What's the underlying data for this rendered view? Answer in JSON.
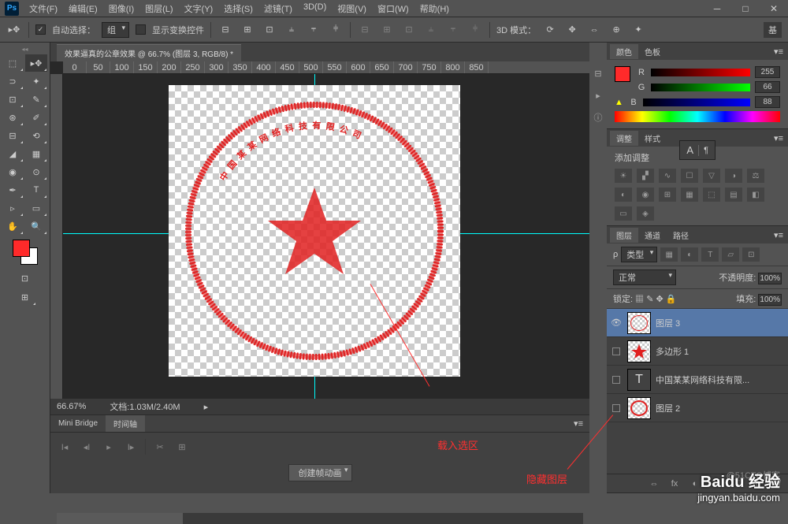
{
  "app": {
    "name": "Ps"
  },
  "menu": [
    "文件(F)",
    "编辑(E)",
    "图像(I)",
    "图层(L)",
    "文字(Y)",
    "选择(S)",
    "滤镜(T)",
    "3D(D)",
    "视图(V)",
    "窗口(W)",
    "帮助(H)"
  ],
  "optionsBar": {
    "autoSelect": "自动选择：",
    "group": "组",
    "showTransform": "显示变换控件",
    "mode3d": "3D 模式："
  },
  "docTab": "效果逼真的公章效果 @ 66.7% (图层 3, RGB/8) *",
  "rulerH": [
    "0",
    "50",
    "100",
    "150",
    "200",
    "250",
    "300",
    "350",
    "400",
    "450",
    "500",
    "550",
    "600",
    "650",
    "700",
    "750",
    "800",
    "850"
  ],
  "status": {
    "zoom": "66.67%",
    "docsize": "文档:1.03M/2.40M"
  },
  "bottomPanel": {
    "tabs": [
      "Mini Bridge",
      "时间轴"
    ],
    "createAnim": "创建帧动画"
  },
  "colorPanel": {
    "tabs": [
      "颜色",
      "色板"
    ],
    "r": {
      "label": "R",
      "value": "255"
    },
    "g": {
      "label": "G",
      "value": "66"
    },
    "b": {
      "label": "B",
      "value": "88"
    }
  },
  "adjustPanel": {
    "tabs": [
      "调整",
      "样式"
    ],
    "addAdjust": "添加调整"
  },
  "layersPanel": {
    "tabs": [
      "图层",
      "通道",
      "路径"
    ],
    "kind": "类型",
    "blend": "正常",
    "opacity": "不透明度:",
    "opacityVal": "100%",
    "lock": "锁定:",
    "fill": "填充:",
    "fillVal": "100%",
    "layers": [
      {
        "name": "图层 3",
        "visible": true,
        "selected": true,
        "type": "raster"
      },
      {
        "name": "多边形 1",
        "visible": false,
        "selected": false,
        "type": "shape"
      },
      {
        "name": "中国某某网络科技有限...",
        "visible": false,
        "selected": false,
        "type": "text"
      },
      {
        "name": "图层 2",
        "visible": false,
        "selected": false,
        "type": "raster"
      }
    ]
  },
  "annotations": {
    "loadSelection": "载入选区",
    "hideLayer": "隐藏图层"
  },
  "watermark": {
    "brand": "Baidu 经验",
    "url": "jingyan.baidu.com",
    "cto": "@51CTO博客"
  }
}
